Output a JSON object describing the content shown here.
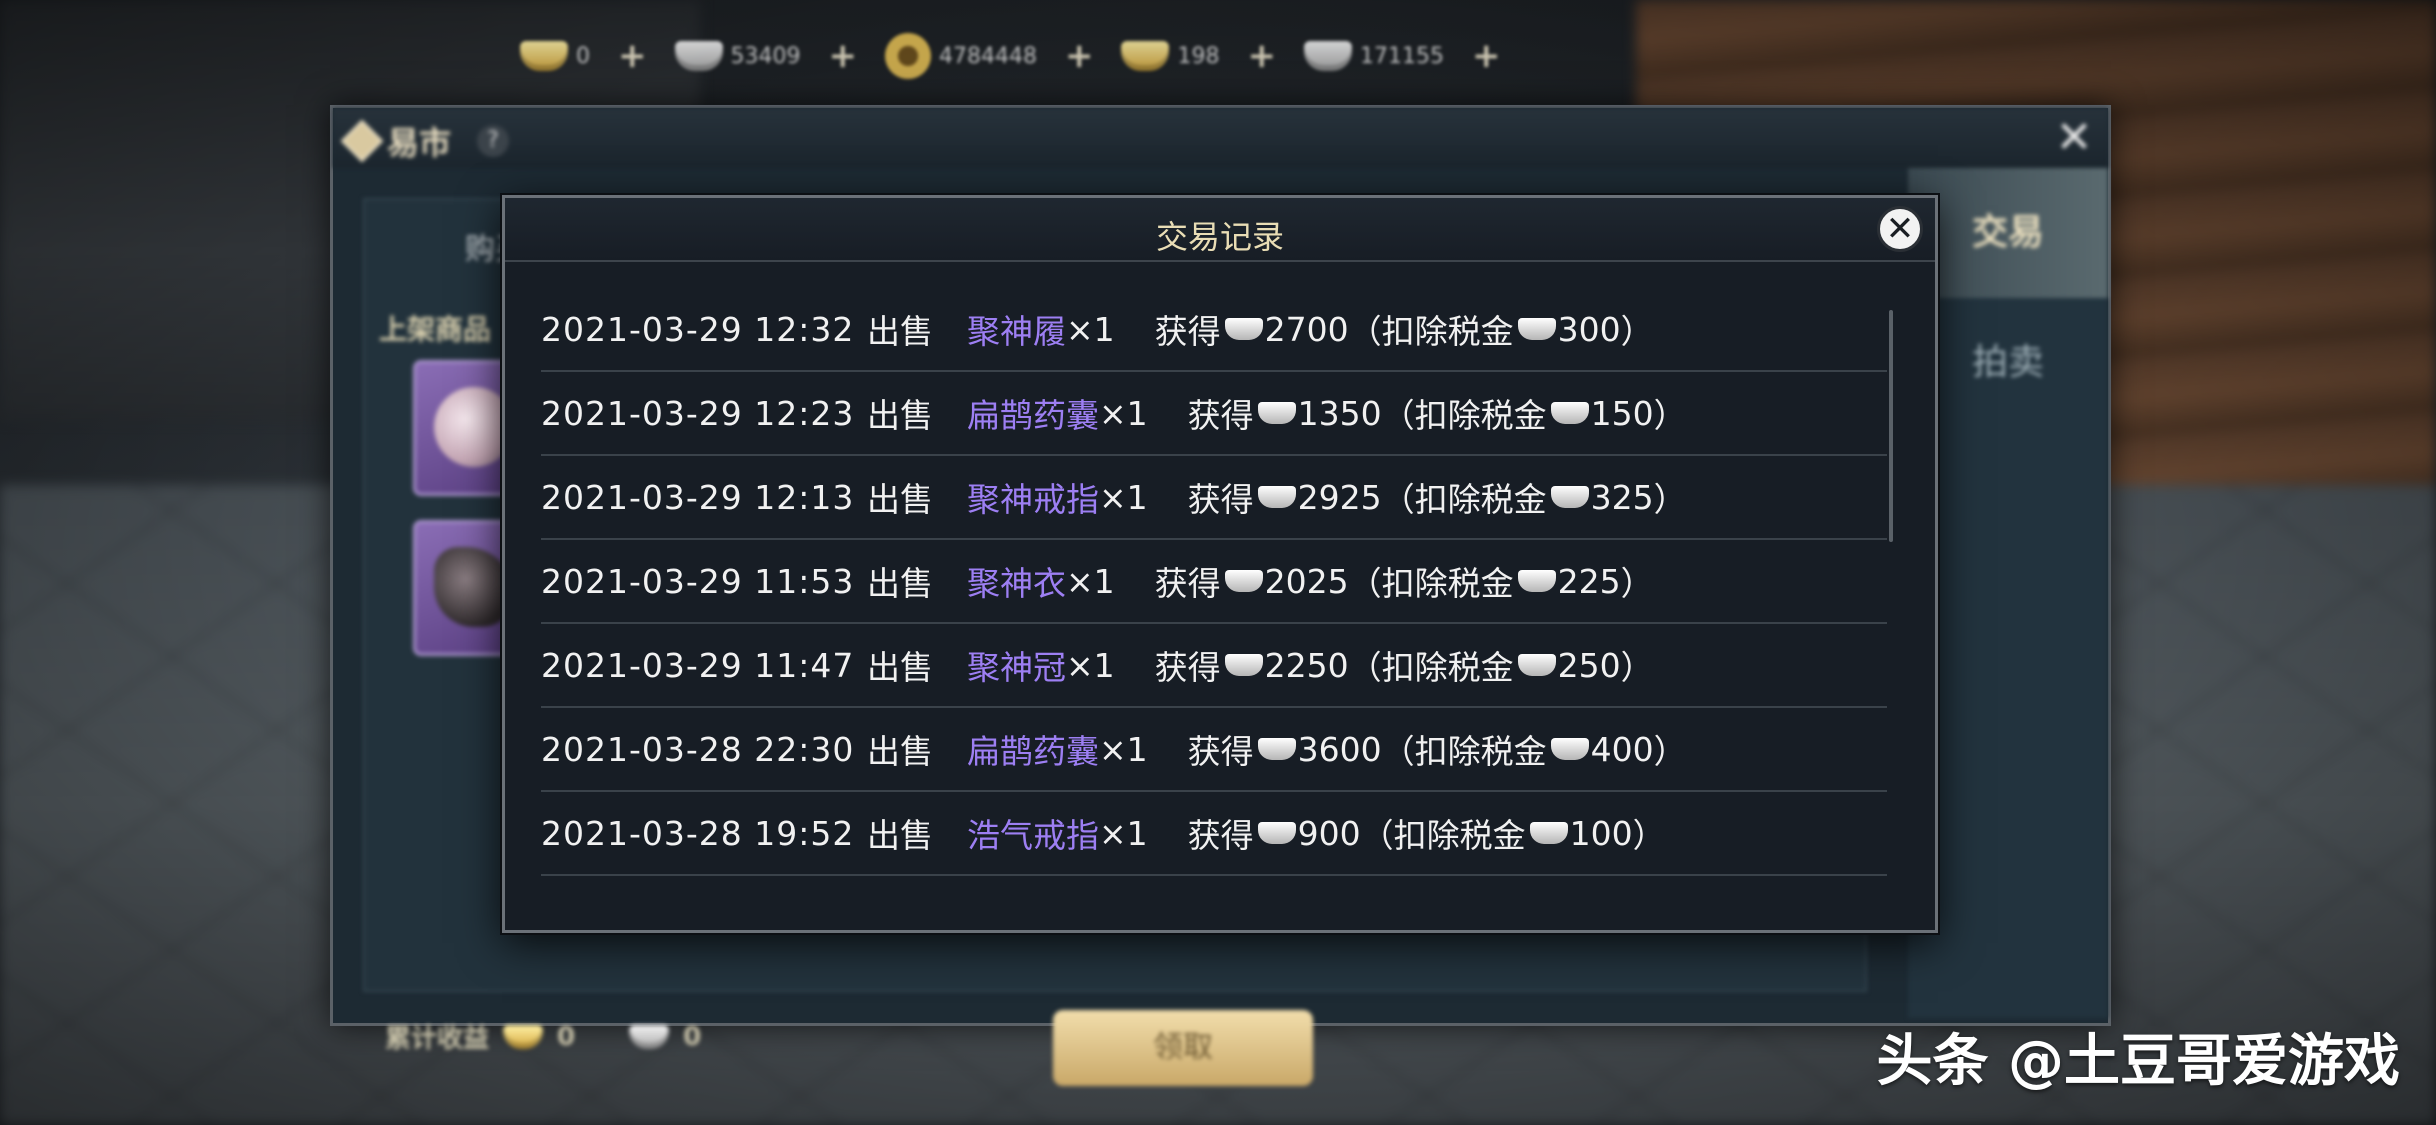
{
  "currency_bar": {
    "items": [
      {
        "icon": "gold-ingot-icon",
        "value": "0"
      },
      {
        "icon": "silver-ingot-icon",
        "value": "53409"
      },
      {
        "icon": "copper-coin-icon",
        "value": "4784448"
      },
      {
        "icon": "gold-ingot-icon",
        "value": "198"
      },
      {
        "icon": "silver-ingot-icon",
        "value": "171155"
      }
    ],
    "plus_glyph": "+"
  },
  "market": {
    "title": "易市",
    "help_glyph": "?",
    "close_glyph": "✕",
    "buy_tab": "购买",
    "listed_label": "上架商品",
    "earnings_label": "累计收益",
    "earnings_gold": "0",
    "earnings_silver": "0",
    "collect_button": "领取",
    "side_tabs": [
      "交易",
      "拍卖"
    ]
  },
  "dialog": {
    "title": "交易记录",
    "close_glyph": "✕",
    "records": [
      {
        "date": "2021-03-29 12:32",
        "action": "出售",
        "item": "聚神履",
        "qty": "×1",
        "gain_label": "获得",
        "gain": "2700",
        "tax_open": "（扣除税金",
        "tax": "300",
        "tax_close": "）"
      },
      {
        "date": "2021-03-29 12:23",
        "action": "出售",
        "item": "扁鹊药囊",
        "qty": "×1",
        "gain_label": "获得",
        "gain": "1350",
        "tax_open": "（扣除税金",
        "tax": "150",
        "tax_close": "）"
      },
      {
        "date": "2021-03-29 12:13",
        "action": "出售",
        "item": "聚神戒指",
        "qty": "×1",
        "gain_label": "获得",
        "gain": "2925",
        "tax_open": "（扣除税金",
        "tax": "325",
        "tax_close": "）"
      },
      {
        "date": "2021-03-29 11:53",
        "action": "出售",
        "item": "聚神衣",
        "qty": "×1",
        "gain_label": "获得",
        "gain": "2025",
        "tax_open": "（扣除税金",
        "tax": "225",
        "tax_close": "）"
      },
      {
        "date": "2021-03-29 11:47",
        "action": "出售",
        "item": "聚神冠",
        "qty": "×1",
        "gain_label": "获得",
        "gain": "2250",
        "tax_open": "（扣除税金",
        "tax": "250",
        "tax_close": "）"
      },
      {
        "date": "2021-03-28 22:30",
        "action": "出售",
        "item": "扁鹊药囊",
        "qty": "×1",
        "gain_label": "获得",
        "gain": "3600",
        "tax_open": "（扣除税金",
        "tax": "400",
        "tax_close": "）"
      },
      {
        "date": "2021-03-28 19:52",
        "action": "出售",
        "item": "浩气戒指",
        "qty": "×1",
        "gain_label": "获得",
        "gain": "900",
        "tax_open": "（扣除税金",
        "tax": "100",
        "tax_close": "）"
      }
    ]
  },
  "watermark": "头条 @土豆哥爱游戏",
  "colors": {
    "item_name": "#9d7ff3",
    "dialog_bg": "#171d25",
    "title_gold": "#e9ddb5"
  }
}
